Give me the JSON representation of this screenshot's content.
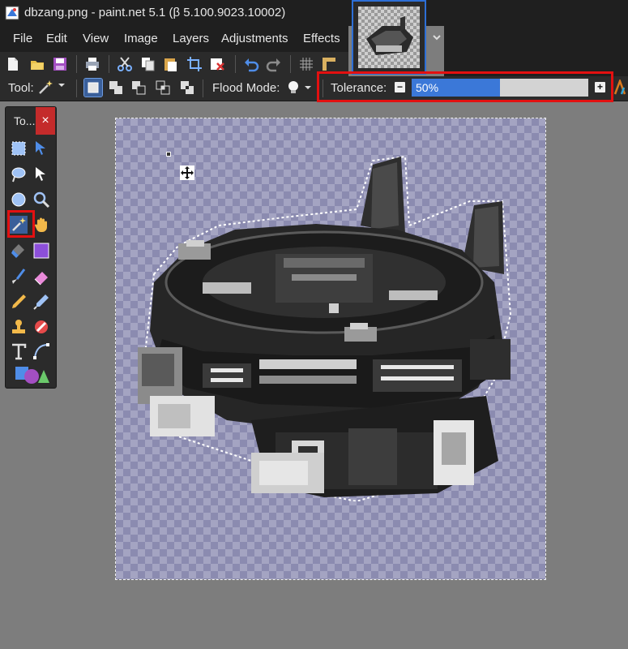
{
  "window": {
    "title": "dbzang.png - paint.net 5.1 (β 5.100.9023.10002)"
  },
  "menu": {
    "file": "File",
    "edit": "Edit",
    "view": "View",
    "image": "Image",
    "layers": "Layers",
    "adjustments": "Adjustments",
    "effects": "Effects"
  },
  "toolbar2": {
    "tool_label": "Tool:",
    "flood_label": "Flood Mode:",
    "tolerance_label": "Tolerance:",
    "tolerance_value": "50%",
    "tolerance_fraction": 0.5
  },
  "tools_panel": {
    "title": "To...",
    "close": "×"
  },
  "colors": {
    "accent": "#3b78d8",
    "highlight": "#e31010",
    "background": "#7d7d7d",
    "panel": "#2b2b2b"
  }
}
